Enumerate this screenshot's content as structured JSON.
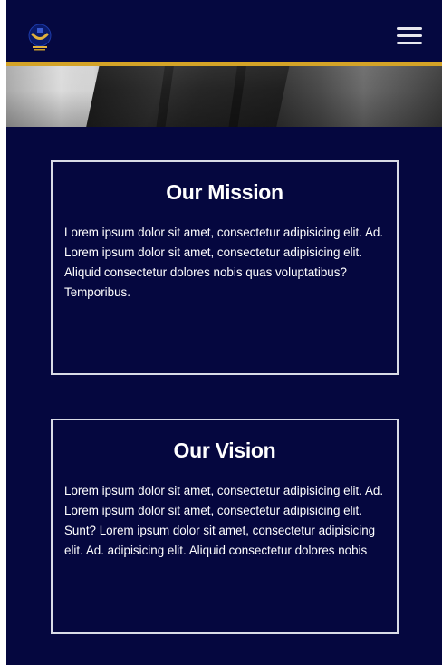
{
  "navbar": {
    "logo_icon": "university-crest-icon",
    "menu_icon": "hamburger-menu-icon"
  },
  "colors": {
    "background": "#05073f",
    "accent_gold": "#d4a327",
    "card_border": "#d9dbe6",
    "text": "#ffffff"
  },
  "mission": {
    "title": "Our Mission",
    "body": "Lorem ipsum dolor sit amet, consectetur adipisicing elit. Ad. Lorem ipsum dolor sit amet, consectetur adipisicing elit. Aliquid consectetur dolores nobis quas voluptatibus? Temporibus."
  },
  "vision": {
    "title": "Our Vision",
    "body": "Lorem ipsum dolor sit amet, consectetur adipisicing elit. Ad. Lorem ipsum dolor sit amet, consectetur adipisicing elit. Sunt? Lorem ipsum dolor sit amet, consectetur adipisicing elit. Ad. adipisicing elit. Aliquid consectetur dolores nobis"
  }
}
